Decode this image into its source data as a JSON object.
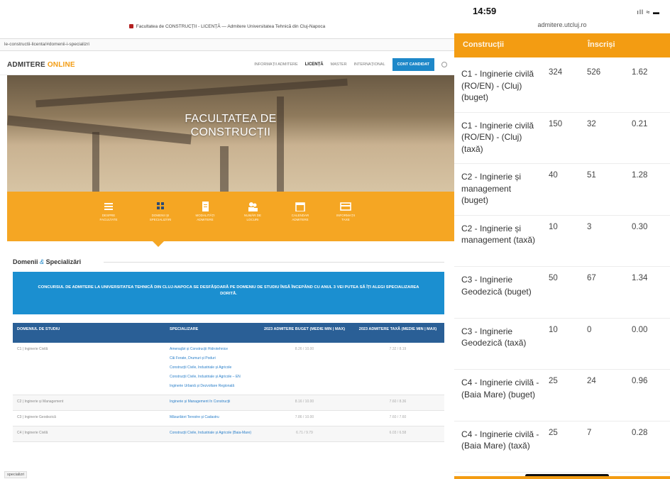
{
  "desktop": {
    "window_title": "Facultatea de CONSTRUCȚII - LICENȚĂ — Admitere Universitatea Tehnică din Cluj-Napoca",
    "url": "le-constructii-licenta/#domenii-i-specializri",
    "logo_main": "ADMITERE",
    "logo_accent": "ONLINE",
    "nav": {
      "items": [
        "INFORMAȚII ADMITERE",
        "LICENȚĂ",
        "MASTER",
        "INTERNAȚIONAL"
      ],
      "cta": "CONT CANDIDAT"
    },
    "hero_title_line1": "FACULTATEA DE",
    "hero_title_line2": "CONSTRUCȚII",
    "icon_tabs": [
      {
        "label1": "DESPRE",
        "label2": "FACULTATE",
        "icon": "menu-icon"
      },
      {
        "label1": "DOMENII ȘI",
        "label2": "SPECIALIZĂRI",
        "icon": "grid-icon"
      },
      {
        "label1": "MODALITĂȚI",
        "label2": "ADMITERE",
        "icon": "document-icon"
      },
      {
        "label1": "NUMĂR DE",
        "label2": "LOCURI",
        "icon": "people-icon"
      },
      {
        "label1": "CALENDAR",
        "label2": "ADMITERE",
        "icon": "calendar-icon"
      },
      {
        "label1": "INFORMAȚII",
        "label2": "TAXE",
        "icon": "card-icon"
      }
    ],
    "section_title_a": "Domenii",
    "section_title_amp": "&",
    "section_title_b": "Specializări",
    "info_text": "CONCURSUL DE ADMITERE LA UNIVERSITATEA TEHNICĂ DIN CLUJ-NAPOCA SE DESFĂȘOARĂ PE DOMENIU DE STUDIU ÎNSĂ ÎNCEPÂND CU ANUL 3 VEI PUTEA SĂ ÎȚI ALEGI SPECIALIZAREA DORITĂ.",
    "table": {
      "headers": [
        "DOMENIUL DE STUDIU",
        "SPECIALIZARE",
        "2023 ADMITERE BUGET (MEDIE MIN | MAX)",
        "2023 ADMITERE TAXĂ (MEDIE MIN | MAX)"
      ],
      "rows": [
        {
          "domain": "C1 | Inginerie Civilă",
          "specs": [
            "Amenajări și Construcții Hidrotehnice",
            "Căi Ferate, Drumuri și Poduri",
            "Construcții Civile, Industriale și Agricole",
            "Construcții Civile, Industriale și Agricole – EN",
            "Inginerie Urbană și Dezvoltare Regională"
          ],
          "buget": "8.26 / 10.00",
          "taxa": "7.32 / 8.19"
        },
        {
          "domain": "C2 | Inginerie și Management",
          "specs": [
            "Inginerie și Management în Construcții"
          ],
          "buget": "8.16 / 10.00",
          "taxa": "7.60 / 8.36"
        },
        {
          "domain": "C3 | Inginerie Geodezică",
          "specs": [
            "Măsurători Terestre și Cadastru"
          ],
          "buget": "7.86 / 10.00",
          "taxa": "7.60 / 7.60"
        },
        {
          "domain": "C4 | Inginerie Civilă",
          "specs": [
            "Construcții Civile, Industriale și Agricole (Baia-Mare)"
          ],
          "buget": "6.71 / 9.79",
          "taxa": "6.03 / 6.58"
        }
      ]
    },
    "status_text": "specializri"
  },
  "mobile": {
    "time": "14:59",
    "signal": "ıll ≈ ▬",
    "url": "admitere.utcluj.ro",
    "head_col1": "Construcții",
    "head_col2": "Înscriși",
    "rows": [
      {
        "name": "C1 - Inginerie civilă (RO/EN) - (Cluj) (buget)",
        "v1": "324",
        "v2": "526",
        "v3": "1.62"
      },
      {
        "name": "C1 - Inginerie civilă (RO/EN) - (Cluj) (taxă)",
        "v1": "150",
        "v2": "32",
        "v3": "0.21"
      },
      {
        "name": "C2 - Inginerie și management (buget)",
        "v1": "40",
        "v2": "51",
        "v3": "1.28"
      },
      {
        "name": "C2 - Inginerie și management (taxă)",
        "v1": "10",
        "v2": "3",
        "v3": "0.30"
      },
      {
        "name": "C3 - Inginerie Geodezică (buget)",
        "v1": "50",
        "v2": "67",
        "v3": "1.34"
      },
      {
        "name": "C3 - Inginerie Geodezică (taxă)",
        "v1": "10",
        "v2": "0",
        "v3": "0.00"
      },
      {
        "name": "C4 - Inginerie civilă - (Baia Mare) (buget)",
        "v1": "25",
        "v2": "24",
        "v3": "0.96"
      },
      {
        "name": "C4 - Inginerie civilă - (Baia Mare) (taxă)",
        "v1": "25",
        "v2": "7",
        "v3": "0.28"
      }
    ]
  },
  "colors": {
    "orange": "#f5a623",
    "blue": "#1b8fd0",
    "navy": "#2a5f96"
  }
}
